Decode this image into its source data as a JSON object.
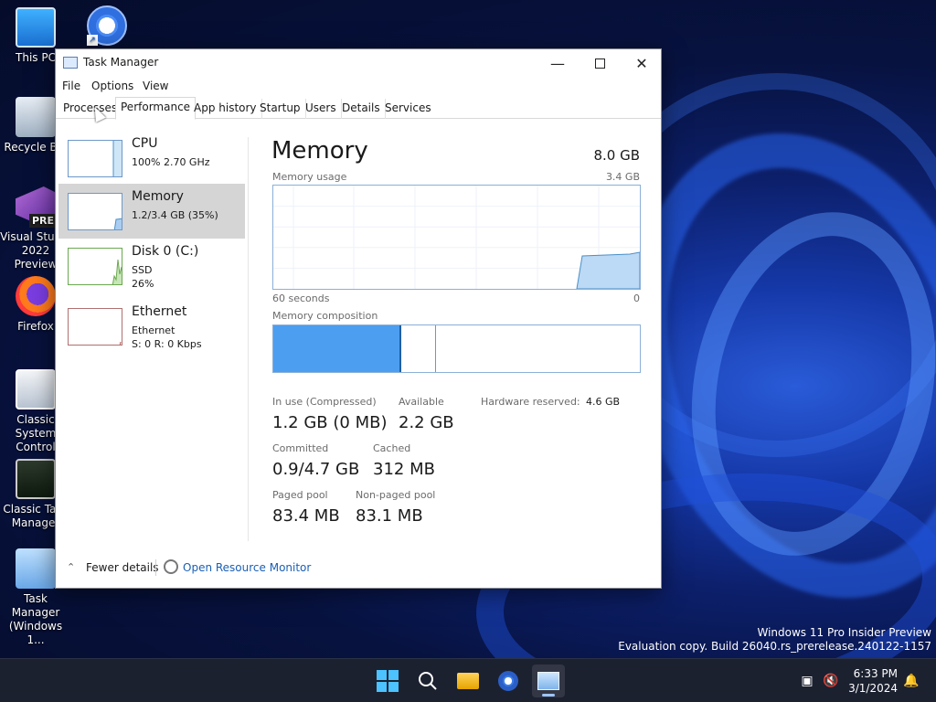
{
  "desktop": {
    "icons": [
      {
        "label": "This PC",
        "icon": "computer-icon"
      },
      {
        "label": "Recycle Bin",
        "icon": "recycle-bin-icon"
      },
      {
        "label": "Visual Studio 2022 Preview",
        "icon": "visual-studio-icon",
        "badge": "PRE"
      },
      {
        "label": "Firefox",
        "icon": "firefox-icon"
      },
      {
        "label": "Classic System Control",
        "icon": "control-panel-icon"
      },
      {
        "label": "Classic Task Manager",
        "icon": "classic-task-manager-icon"
      },
      {
        "label": "Task Manager (Windows 1...",
        "icon": "task-manager-icon"
      },
      {
        "label": "",
        "icon": "chrome-icon"
      }
    ],
    "watermark": {
      "line1": "Windows 11 Pro Insider Preview",
      "line2": "Evaluation copy. Build 26040.rs_prerelease.240122-1157"
    }
  },
  "window": {
    "title": "Task Manager",
    "menu": [
      "File",
      "Options",
      "View"
    ],
    "tabs": [
      "Processes",
      "Performance",
      "App history",
      "Startup",
      "Users",
      "Details",
      "Services"
    ],
    "active_tab": "Performance",
    "sidebar": [
      {
        "name": "CPU",
        "sub1": "100% 2.70 GHz",
        "sub2": ""
      },
      {
        "name": "Memory",
        "sub1": "1.2/3.4 GB (35%)",
        "sub2": ""
      },
      {
        "name": "Disk 0 (C:)",
        "sub1": "SSD",
        "sub2": "26%"
      },
      {
        "name": "Ethernet",
        "sub1": "Ethernet",
        "sub2": "S: 0  R: 0 Kbps"
      }
    ],
    "main": {
      "title": "Memory",
      "total": "8.0 GB",
      "usage_label": "Memory usage",
      "usage_max": "3.4 GB",
      "time_label": "60 seconds",
      "time_zero": "0",
      "composition_label": "Memory composition",
      "composition": {
        "in_use_fraction": 0.35,
        "modified_fraction": 0.09
      },
      "stats": {
        "in_use_label": "In use (Compressed)",
        "in_use_value": "1.2 GB (0 MB)",
        "available_label": "Available",
        "available_value": "2.2 GB",
        "hw_reserved_label": "Hardware reserved:",
        "hw_reserved_value": "4.6 GB",
        "committed_label": "Committed",
        "committed_value": "0.9/4.7 GB",
        "cached_label": "Cached",
        "cached_value": "312 MB",
        "paged_label": "Paged pool",
        "paged_value": "83.4 MB",
        "nonpaged_label": "Non-paged pool",
        "nonpaged_value": "83.1 MB"
      }
    },
    "footer": {
      "fewer_details": "Fewer details",
      "resource_monitor": "Open Resource Monitor"
    }
  },
  "taskbar": {
    "time": "6:33 PM",
    "date": "3/1/2024",
    "apps": [
      "start-icon",
      "search-icon",
      "file-explorer-icon",
      "chrome-icon",
      "task-manager-icon"
    ]
  },
  "colors": {
    "accent": "#4c9ef0",
    "graph_border": "#8ab0d8",
    "link": "#1a5fb4"
  }
}
